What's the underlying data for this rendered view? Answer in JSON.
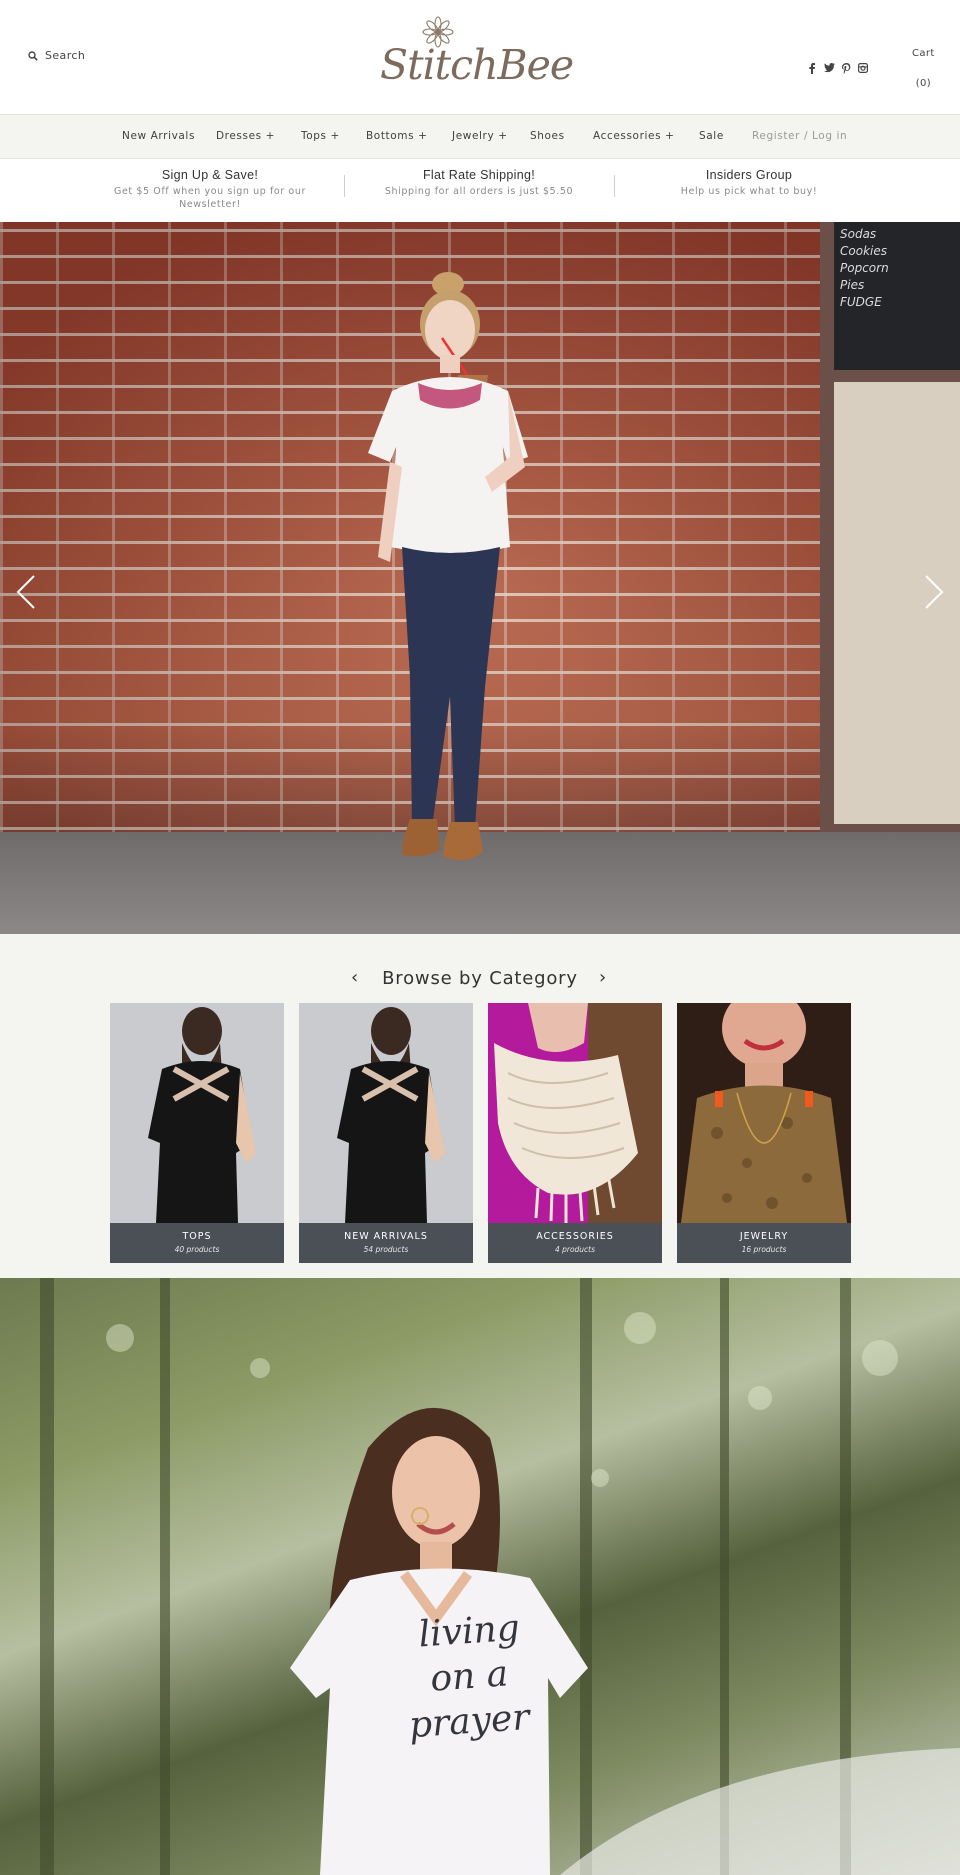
{
  "header": {
    "search_label": "Search",
    "logo_text": "StitchBee",
    "cart_label": "Cart",
    "cart_count": "(0)",
    "social_icons": [
      "facebook-icon",
      "twitter-icon",
      "pinterest-icon",
      "instagram-icon"
    ]
  },
  "nav": {
    "items": [
      "New Arrivals",
      "Dresses +",
      "Tops +",
      "Bottoms +",
      "Jewelry +",
      "Shoes",
      "Accessories +",
      "Sale"
    ],
    "account": "Register / Log in"
  },
  "promos": [
    {
      "title": "Sign Up & Save!",
      "subtitle": "Get $5 Off when you sign up for our Newsletter!"
    },
    {
      "title": "Flat Rate Shipping!",
      "subtitle": "Shipping for all orders is just $5.50"
    },
    {
      "title": "Insiders Group",
      "subtitle": "Help us pick what to buy!"
    }
  ],
  "hero": {
    "chalkboard_text": "Sodas\nCookies\nPopcorn\nPies\nFUDGE",
    "prev_icon": "chevron-left-icon",
    "next_icon": "chevron-right-icon"
  },
  "browse": {
    "heading": "Browse by Category",
    "prev_glyph": "‹",
    "next_glyph": "›",
    "categories": [
      {
        "title": "TOPS",
        "count": "40 products"
      },
      {
        "title": "NEW ARRIVALS",
        "count": "54 products"
      },
      {
        "title": "ACCESSORIES",
        "count": "4 products"
      },
      {
        "title": "JEWELRY",
        "count": "16 products"
      }
    ]
  },
  "banner": {
    "shirt_text": "living on a prayer"
  },
  "colors": {
    "nav_bg": "#f4f4f0",
    "caption_bg": "#4b4f56",
    "logo": "#7d6b5d"
  }
}
